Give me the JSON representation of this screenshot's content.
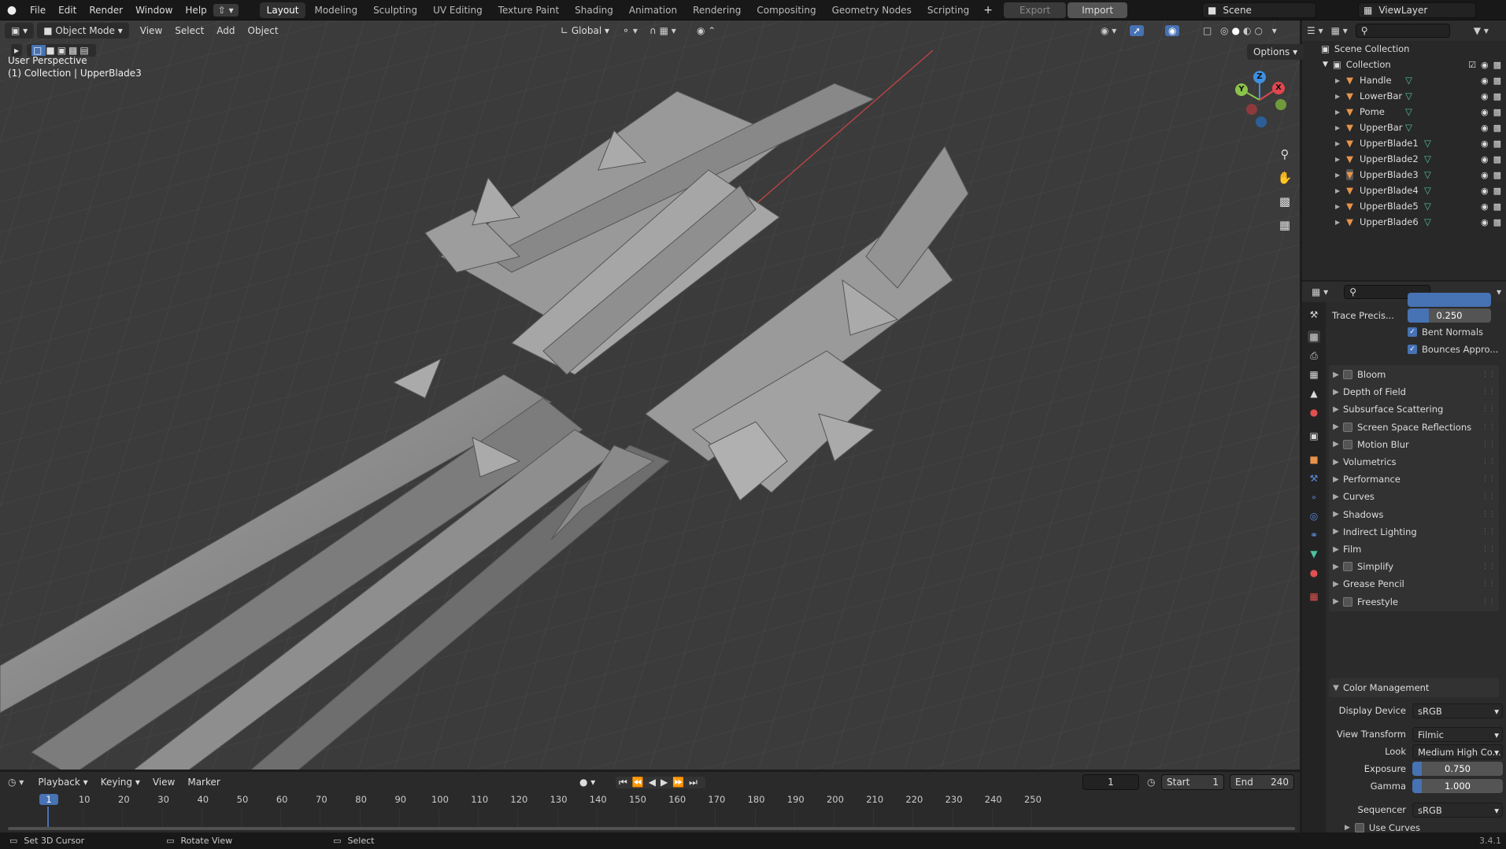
{
  "menu": {
    "file": "File",
    "edit": "Edit",
    "render": "Render",
    "window": "Window",
    "help": "Help"
  },
  "workspaces": [
    "Layout",
    "Modeling",
    "Sculpting",
    "UV Editing",
    "Texture Paint",
    "Shading",
    "Animation",
    "Rendering",
    "Compositing",
    "Geometry Nodes",
    "Scripting"
  ],
  "add_tab": "+",
  "export_label": "Export",
  "import_label": "Import",
  "scene": "Scene",
  "view_layer": "ViewLayer",
  "viewport": {
    "mode": "Object Mode",
    "menus": [
      "View",
      "Select",
      "Add",
      "Object"
    ],
    "orientation": "Global",
    "options": "Options",
    "overlay_title": "User Perspective",
    "overlay_sub": "(1) Collection | UpperBlade3"
  },
  "gizmo": {
    "x": "X",
    "y": "Y",
    "z": "Z"
  },
  "outliner": {
    "scene_collection": "Scene Collection",
    "collection": "Collection",
    "items": [
      "Handle",
      "LowerBar",
      "Pome",
      "UpperBar",
      "UpperBlade1",
      "UpperBlade2",
      "UpperBlade3",
      "UpperBlade4",
      "UpperBlade5",
      "UpperBlade6"
    ],
    "active": "UpperBlade3"
  },
  "props": {
    "trace_label": "Trace Precis...",
    "trace_value": "0.250",
    "trace_fill": 0.25,
    "bent_normals": "Bent Normals",
    "bounces": "Bounces Appro...",
    "panels": [
      {
        "label": "Bloom",
        "checkbox": true
      },
      {
        "label": "Depth of Field",
        "checkbox": false
      },
      {
        "label": "Subsurface Scattering",
        "checkbox": false
      },
      {
        "label": "Screen Space Reflections",
        "checkbox": true
      },
      {
        "label": "Motion Blur",
        "checkbox": true
      },
      {
        "label": "Volumetrics",
        "checkbox": false
      },
      {
        "label": "Performance",
        "checkbox": false
      },
      {
        "label": "Curves",
        "checkbox": false
      },
      {
        "label": "Shadows",
        "checkbox": false
      },
      {
        "label": "Indirect Lighting",
        "checkbox": false
      },
      {
        "label": "Film",
        "checkbox": false
      },
      {
        "label": "Simplify",
        "checkbox": true
      },
      {
        "label": "Grease Pencil",
        "checkbox": false
      },
      {
        "label": "Freestyle",
        "checkbox": true
      }
    ],
    "color_mgmt": "Color Management",
    "display_device_label": "Display Device",
    "display_device": "sRGB",
    "view_transform_label": "View Transform",
    "view_transform": "Filmic",
    "look_label": "Look",
    "look": "Medium High Co...",
    "exposure_label": "Exposure",
    "exposure": "0.750",
    "exposure_fill": 0.1,
    "gamma_label": "Gamma",
    "gamma": "1.000",
    "gamma_fill": 0.1,
    "sequencer_label": "Sequencer",
    "sequencer": "sRGB",
    "use_curves": "Use Curves"
  },
  "timeline": {
    "menus": [
      "Playback",
      "Keying",
      "View",
      "Marker"
    ],
    "current_frame": "1",
    "start_label": "Start",
    "start": "1",
    "end_label": "End",
    "end": "240",
    "ticks": [
      "1",
      "10",
      "20",
      "30",
      "40",
      "50",
      "60",
      "70",
      "80",
      "90",
      "100",
      "110",
      "120",
      "130",
      "140",
      "150",
      "160",
      "170",
      "180",
      "190",
      "200",
      "210",
      "220",
      "230",
      "240",
      "250"
    ]
  },
  "status": {
    "left": "Set 3D Cursor",
    "mid": "Rotate View",
    "right": "Select",
    "version": "3.4.1"
  },
  "colors": {
    "accent": "#4772b3",
    "object": "#e8934a",
    "mesh": "#4ec2a0",
    "x_axis": "#e0474f",
    "y_axis": "#8bc34a",
    "z_axis": "#3f8fe0"
  }
}
